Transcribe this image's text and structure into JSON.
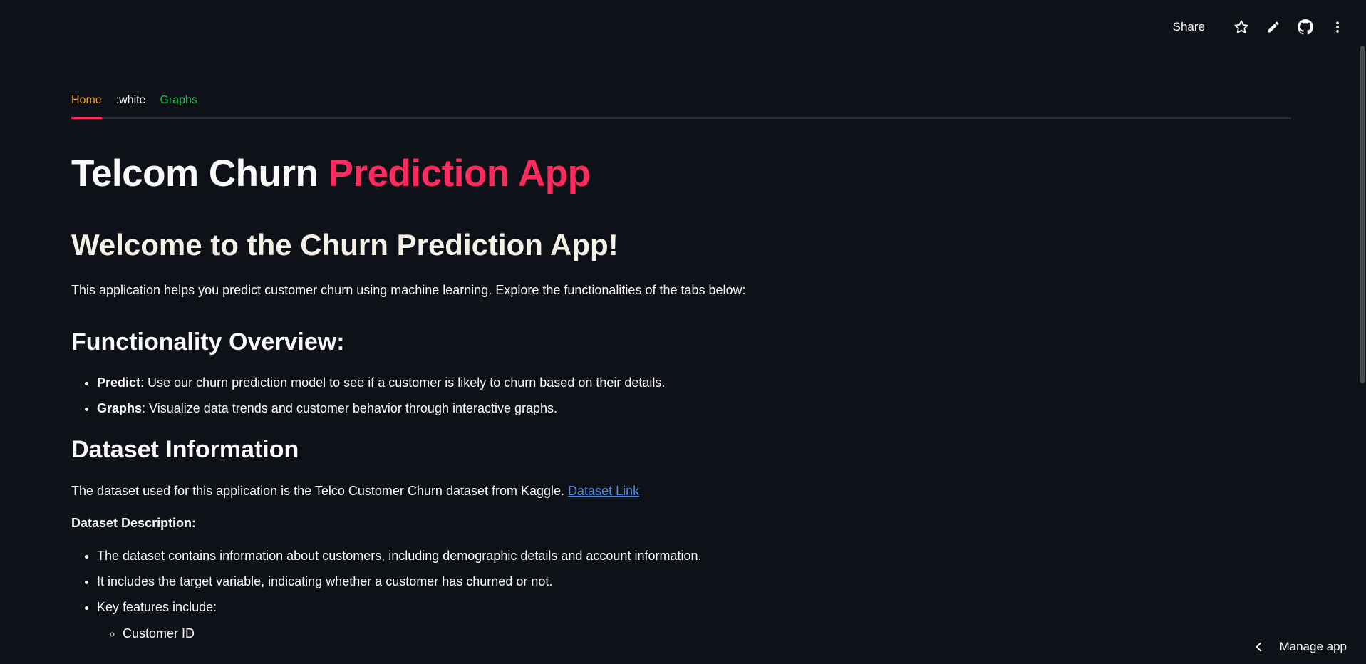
{
  "toolbar": {
    "share_label": "Share",
    "icons": [
      "star-icon",
      "pencil-icon",
      "github-icon",
      "more-vertical-icon"
    ]
  },
  "tabs": [
    {
      "label": "Home",
      "color": "#f7a11b",
      "active": true
    },
    {
      "label": ":white",
      "color": "#fafafa",
      "active": false
    },
    {
      "label": "Graphs",
      "color": "#21c354",
      "active": false
    }
  ],
  "header": {
    "title_part1": "Telcom Churn ",
    "title_part2": "Prediction App",
    "accent_color": "#ff2b5e"
  },
  "welcome": {
    "heading": "Welcome to the Churn Prediction App!",
    "intro": "This application helps you predict customer churn using machine learning. Explore the functionalities of the tabs below:"
  },
  "functionality": {
    "heading": "Functionality Overview:",
    "items": [
      {
        "bold": "Predict",
        "text": ": Use our churn prediction model to see if a customer is likely to churn based on their details."
      },
      {
        "bold": "Graphs",
        "text": ": Visualize data trends and customer behavior through interactive graphs."
      }
    ]
  },
  "dataset": {
    "heading": "Dataset Information",
    "text": "The dataset used for this application is the Telco Customer Churn dataset from Kaggle. ",
    "link_label": "Dataset Link",
    "description_label": "Dataset Description:",
    "items": [
      "The dataset contains information about customers, including demographic details and account information.",
      "It includes the target variable, indicating whether a customer has churned or not.",
      "Key features include:"
    ],
    "sub_items": [
      "Customer ID"
    ]
  },
  "footer": {
    "manage_label": "Manage app"
  }
}
